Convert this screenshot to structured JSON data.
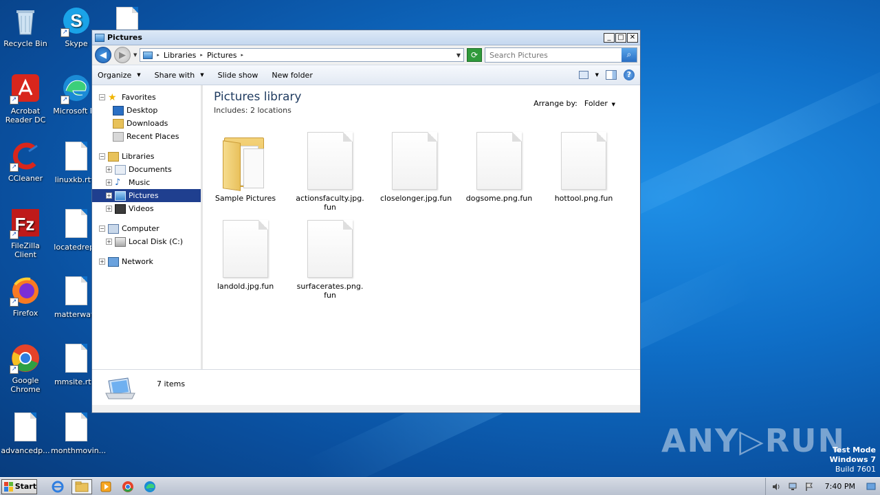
{
  "desktop": {
    "icons": [
      {
        "label": "Recycle Bin"
      },
      {
        "label": "Skype"
      },
      {
        "label": "Acrobat Reader DC"
      },
      {
        "label": "Microsoft Ed"
      },
      {
        "label": "CCleaner"
      },
      {
        "label": "linuxkb.rtf.f"
      },
      {
        "label": "FileZilla Client"
      },
      {
        "label": "locatedrepa"
      },
      {
        "label": "Firefox"
      },
      {
        "label": "matterwate"
      },
      {
        "label": "Google Chrome"
      },
      {
        "label": "mmsite.rtf.f"
      },
      {
        "label": "advancedp..."
      },
      {
        "label": "monthmovin..."
      }
    ]
  },
  "window": {
    "title": "Pictures",
    "controls": {
      "minimize": "_",
      "maximize": "□",
      "close": "✕"
    },
    "address": {
      "crumbs": [
        "Libraries",
        "Pictures"
      ]
    },
    "search": {
      "placeholder": "Search Pictures"
    },
    "commands": {
      "organize": "Organize",
      "share_with": "Share with",
      "slide_show": "Slide show",
      "new_folder": "New folder",
      "help": "?"
    },
    "nav": {
      "favorites": "Favorites",
      "desktop": "Desktop",
      "downloads": "Downloads",
      "recent_places": "Recent Places",
      "libraries": "Libraries",
      "documents": "Documents",
      "music": "Music",
      "pictures": "Pictures",
      "videos": "Videos",
      "computer": "Computer",
      "local_disk": "Local Disk (C:)",
      "network": "Network"
    },
    "content": {
      "title": "Pictures library",
      "includes_label": "Includes:",
      "includes_value": "2 locations",
      "arrange_label": "Arrange by:",
      "arrange_value": "Folder",
      "items": [
        {
          "name": "Sample Pictures",
          "kind": "folder"
        },
        {
          "name": "actionsfaculty.jpg.fun",
          "kind": "file"
        },
        {
          "name": "closelonger.jpg.fun",
          "kind": "file"
        },
        {
          "name": "dogsome.png.fun",
          "kind": "file"
        },
        {
          "name": "hottool.png.fun",
          "kind": "file"
        },
        {
          "name": "landold.jpg.fun",
          "kind": "file"
        },
        {
          "name": "surfacerates.png.fun",
          "kind": "file"
        }
      ]
    },
    "details": {
      "count": "7 items"
    }
  },
  "watermark": {
    "text": "ANY▷RUN"
  },
  "test_mode": {
    "line1": "Test Mode",
    "line2": "Windows 7",
    "line3": "Build 7601"
  },
  "taskbar": {
    "start": "Start",
    "clock": "7:40 PM"
  }
}
